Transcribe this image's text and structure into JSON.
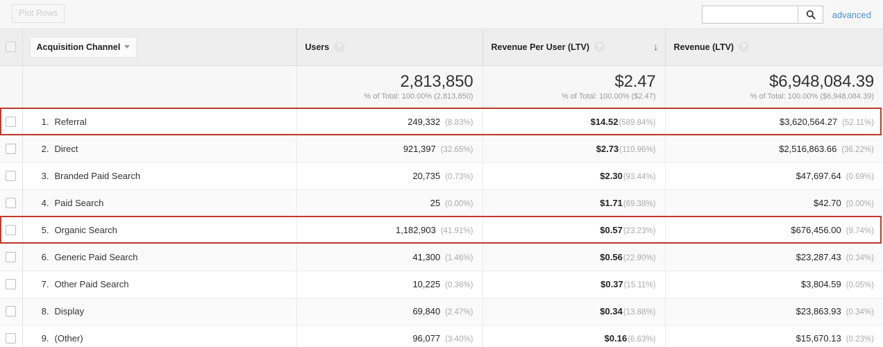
{
  "toolbar": {
    "plot_rows_label": "Plot Rows",
    "search_value": "",
    "search_placeholder": "",
    "search_icon": "search-icon",
    "advanced_label": "advanced"
  },
  "table": {
    "dimension_selector": {
      "label": "Acquisition Channel",
      "caret_icon": "chevron-down-icon"
    },
    "columns": [
      {
        "label": "Users",
        "help_icon": "help-icon",
        "sorted": false
      },
      {
        "label": "Revenue Per User (LTV)",
        "help_icon": "help-icon",
        "sorted": true,
        "sort_icon": "arrow-down-icon",
        "sort_direction": "descending"
      },
      {
        "label": "Revenue (LTV)",
        "help_icon": "help-icon",
        "sorted": false
      }
    ],
    "summary": {
      "users_value": "2,813,850",
      "users_sub": "% of Total: 100.00% (2,813,850)",
      "rpu_value": "$2.47",
      "rpu_sub": "% of Total: 100.00% ($2.47)",
      "revenue_value": "$6,948,084.39",
      "revenue_sub": "% of Total: 100.00% ($6,948,084.39)"
    },
    "rows": [
      {
        "rank": "1.",
        "name": "Referral",
        "users": "249,332",
        "users_pct": "(8.83%)",
        "rpu": "$14.52",
        "rpu_pct": "(589.84%)",
        "revenue": "$3,620,564.27",
        "revenue_pct": "(52.11%)",
        "highlighted": true
      },
      {
        "rank": "2.",
        "name": "Direct",
        "users": "921,397",
        "users_pct": "(32.65%)",
        "rpu": "$2.73",
        "rpu_pct": "(110.96%)",
        "revenue": "$2,516,863.66",
        "revenue_pct": "(36.22%)",
        "highlighted": false
      },
      {
        "rank": "3.",
        "name": "Branded Paid Search",
        "users": "20,735",
        "users_pct": "(0.73%)",
        "rpu": "$2.30",
        "rpu_pct": "(93.44%)",
        "revenue": "$47,697.64",
        "revenue_pct": "(0.69%)",
        "highlighted": false
      },
      {
        "rank": "4.",
        "name": "Paid Search",
        "users": "25",
        "users_pct": "(0.00%)",
        "rpu": "$1.71",
        "rpu_pct": "(69.38%)",
        "revenue": "$42.70",
        "revenue_pct": "(0.00%)",
        "highlighted": false
      },
      {
        "rank": "5.",
        "name": "Organic Search",
        "users": "1,182,903",
        "users_pct": "(41.91%)",
        "rpu": "$0.57",
        "rpu_pct": "(23.23%)",
        "revenue": "$676,456.00",
        "revenue_pct": "(9.74%)",
        "highlighted": true
      },
      {
        "rank": "6.",
        "name": "Generic Paid Search",
        "users": "41,300",
        "users_pct": "(1.46%)",
        "rpu": "$0.56",
        "rpu_pct": "(22.90%)",
        "revenue": "$23,287.43",
        "revenue_pct": "(0.34%)",
        "highlighted": false
      },
      {
        "rank": "7.",
        "name": "Other Paid Search",
        "users": "10,225",
        "users_pct": "(0.36%)",
        "rpu": "$0.37",
        "rpu_pct": "(15.11%)",
        "revenue": "$3,804.59",
        "revenue_pct": "(0.05%)",
        "highlighted": false
      },
      {
        "rank": "8.",
        "name": "Display",
        "users": "69,840",
        "users_pct": "(2.47%)",
        "rpu": "$0.34",
        "rpu_pct": "(13.88%)",
        "revenue": "$23,863.93",
        "revenue_pct": "(0.34%)",
        "highlighted": false
      },
      {
        "rank": "9.",
        "name": "(Other)",
        "users": "96,077",
        "users_pct": "(3.40%)",
        "rpu": "$0.16",
        "rpu_pct": "(6.63%)",
        "revenue": "$15,670.13",
        "revenue_pct": "(0.23%)",
        "highlighted": false
      }
    ]
  },
  "colors": {
    "highlight_border": "#c0392b",
    "link": "#4a90d9",
    "header_bg": "#eeeeee"
  }
}
